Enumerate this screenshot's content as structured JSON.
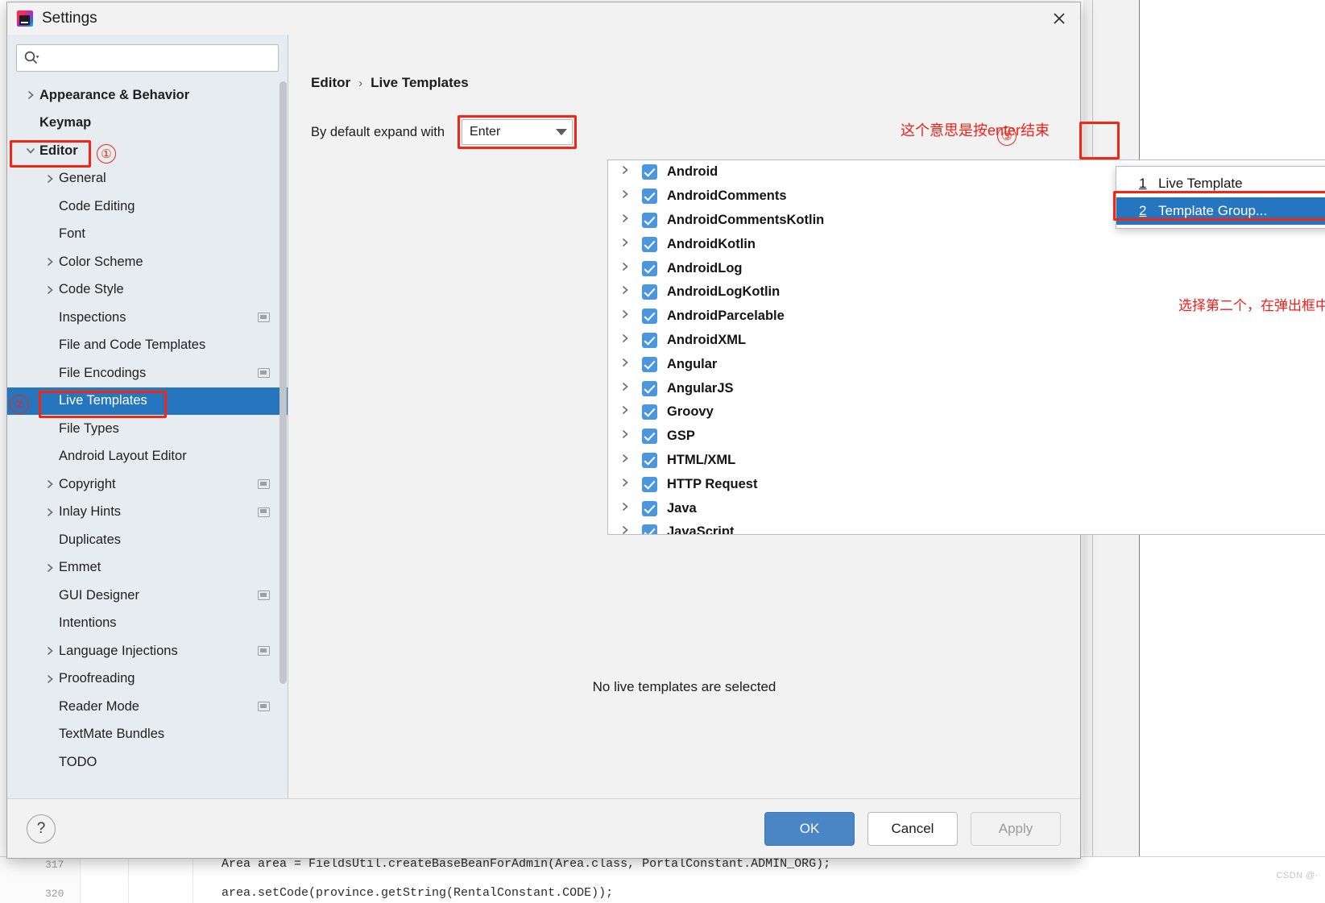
{
  "window": {
    "title": "Settings",
    "logo_icon": "intellij-idea-logo",
    "close_icon": "close-icon"
  },
  "search": {
    "placeholder": "",
    "value": "",
    "icon": "search-icon"
  },
  "sidebar": {
    "items": [
      {
        "label": "Appearance & Behavior",
        "level": 0,
        "chevron": true,
        "bold": true,
        "selected": false,
        "badge": false
      },
      {
        "label": "Keymap",
        "level": 0,
        "chevron": false,
        "bold": true,
        "selected": false,
        "badge": false
      },
      {
        "label": "Editor",
        "level": 0,
        "chevron": true,
        "expanded": true,
        "bold": true,
        "selected": false,
        "badge": false
      },
      {
        "label": "General",
        "level": 1,
        "chevron": true,
        "bold": false,
        "selected": false,
        "badge": false
      },
      {
        "label": "Code Editing",
        "level": 1,
        "chevron": false,
        "bold": false,
        "selected": false,
        "badge": false
      },
      {
        "label": "Font",
        "level": 1,
        "chevron": false,
        "bold": false,
        "selected": false,
        "badge": false
      },
      {
        "label": "Color Scheme",
        "level": 1,
        "chevron": true,
        "bold": false,
        "selected": false,
        "badge": false
      },
      {
        "label": "Code Style",
        "level": 1,
        "chevron": true,
        "bold": false,
        "selected": false,
        "badge": false
      },
      {
        "label": "Inspections",
        "level": 1,
        "chevron": false,
        "bold": false,
        "selected": false,
        "badge": true
      },
      {
        "label": "File and Code Templates",
        "level": 1,
        "chevron": false,
        "bold": false,
        "selected": false,
        "badge": false
      },
      {
        "label": "File Encodings",
        "level": 1,
        "chevron": false,
        "bold": false,
        "selected": false,
        "badge": true
      },
      {
        "label": "Live Templates",
        "level": 1,
        "chevron": false,
        "bold": false,
        "selected": true,
        "badge": false
      },
      {
        "label": "File Types",
        "level": 1,
        "chevron": false,
        "bold": false,
        "selected": false,
        "badge": false
      },
      {
        "label": "Android Layout Editor",
        "level": 1,
        "chevron": false,
        "bold": false,
        "selected": false,
        "badge": false
      },
      {
        "label": "Copyright",
        "level": 1,
        "chevron": true,
        "bold": false,
        "selected": false,
        "badge": true
      },
      {
        "label": "Inlay Hints",
        "level": 1,
        "chevron": true,
        "bold": false,
        "selected": false,
        "badge": true
      },
      {
        "label": "Duplicates",
        "level": 1,
        "chevron": false,
        "bold": false,
        "selected": false,
        "badge": false
      },
      {
        "label": "Emmet",
        "level": 1,
        "chevron": true,
        "bold": false,
        "selected": false,
        "badge": false
      },
      {
        "label": "GUI Designer",
        "level": 1,
        "chevron": false,
        "bold": false,
        "selected": false,
        "badge": true
      },
      {
        "label": "Intentions",
        "level": 1,
        "chevron": false,
        "bold": false,
        "selected": false,
        "badge": false
      },
      {
        "label": "Language Injections",
        "level": 1,
        "chevron": true,
        "bold": false,
        "selected": false,
        "badge": true
      },
      {
        "label": "Proofreading",
        "level": 1,
        "chevron": true,
        "bold": false,
        "selected": false,
        "badge": false
      },
      {
        "label": "Reader Mode",
        "level": 1,
        "chevron": false,
        "bold": false,
        "selected": false,
        "badge": true
      },
      {
        "label": "TextMate Bundles",
        "level": 1,
        "chevron": false,
        "bold": false,
        "selected": false,
        "badge": false
      },
      {
        "label": "TODO",
        "level": 1,
        "chevron": false,
        "bold": false,
        "selected": false,
        "badge": false
      }
    ]
  },
  "content": {
    "breadcrumb": {
      "parent": "Editor",
      "separator": "›",
      "current": "Live Templates"
    },
    "expand_label": "By default expand with",
    "expand_value": "Enter",
    "empty_note": "No live templates are selected",
    "templates": [
      {
        "label": "Android",
        "checked": true
      },
      {
        "label": "AndroidComments",
        "checked": true
      },
      {
        "label": "AndroidCommentsKotlin",
        "checked": true
      },
      {
        "label": "AndroidKotlin",
        "checked": true
      },
      {
        "label": "AndroidLog",
        "checked": true
      },
      {
        "label": "AndroidLogKotlin",
        "checked": true
      },
      {
        "label": "AndroidParcelable",
        "checked": true
      },
      {
        "label": "AndroidXML",
        "checked": true
      },
      {
        "label": "Angular",
        "checked": true
      },
      {
        "label": "AngularJS",
        "checked": true
      },
      {
        "label": "Groovy",
        "checked": true
      },
      {
        "label": "GSP",
        "checked": true
      },
      {
        "label": "HTML/XML",
        "checked": true
      },
      {
        "label": "HTTP Request",
        "checked": true
      },
      {
        "label": "Java",
        "checked": true
      },
      {
        "label": "JavaScript",
        "checked": true
      }
    ],
    "toolbar": {
      "add_icon": "plus-icon",
      "revert_icon": "undo-arrow-icon"
    },
    "popup": {
      "items": [
        {
          "mnemonic": "1",
          "label": "Live Template",
          "active": false
        },
        {
          "mnemonic": "2",
          "label": "Template Group...",
          "active": true
        }
      ]
    }
  },
  "annotations": {
    "enter_note": "这个意思是按enter结束",
    "group_note": "选择第二个，在弹出框中命名自己的快捷键模版组名",
    "marker1": "①",
    "marker2": "②",
    "marker3": "③",
    "accent_color": "#f22613"
  },
  "footer": {
    "help_label": "?",
    "ok_label": "OK",
    "cancel_label": "Cancel",
    "apply_label": "Apply"
  },
  "background": {
    "line_numbers": [
      "317",
      "320"
    ],
    "code_line_1": "Area area = FieldsUtil.createBaseBeanForAdmin(Area.class, PortalConstant.ADMIN_ORG);",
    "code_line_2": "area.setCode(province.getString(RentalConstant.CODE));",
    "watermark": "CSDN @·"
  }
}
